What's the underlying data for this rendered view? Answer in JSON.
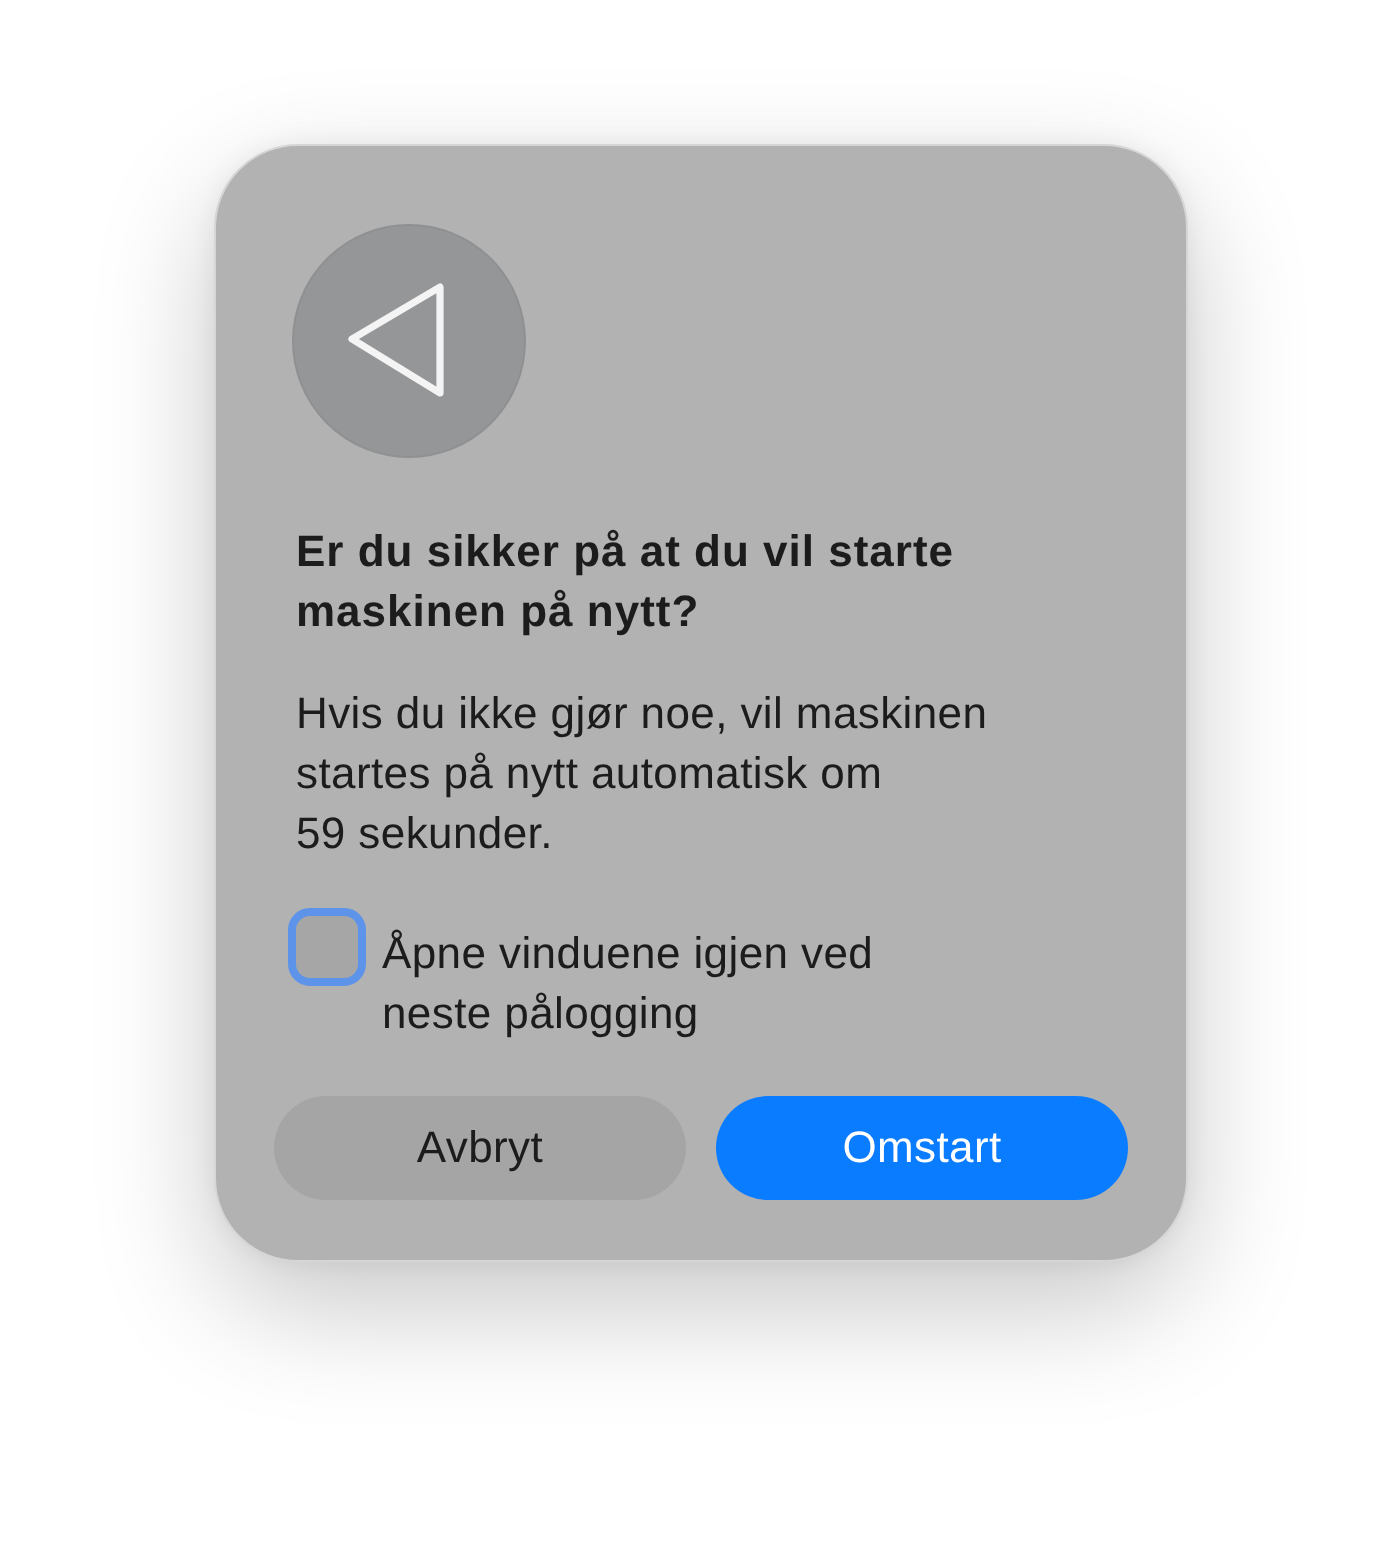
{
  "dialog": {
    "title": "Er du sikker på at du vil starte maskinen på nytt?",
    "message": "Hvis du ikke gjør noe, vil maskinen startes på nytt automatisk om 59 sekunder.",
    "checkbox": {
      "label": "Åpne vinduene igjen ved neste pålogging",
      "checked": false,
      "focused": true
    },
    "buttons": [
      {
        "label": "Avbryt",
        "kind": "secondary"
      },
      {
        "label": "Omstart",
        "kind": "primary"
      }
    ]
  }
}
